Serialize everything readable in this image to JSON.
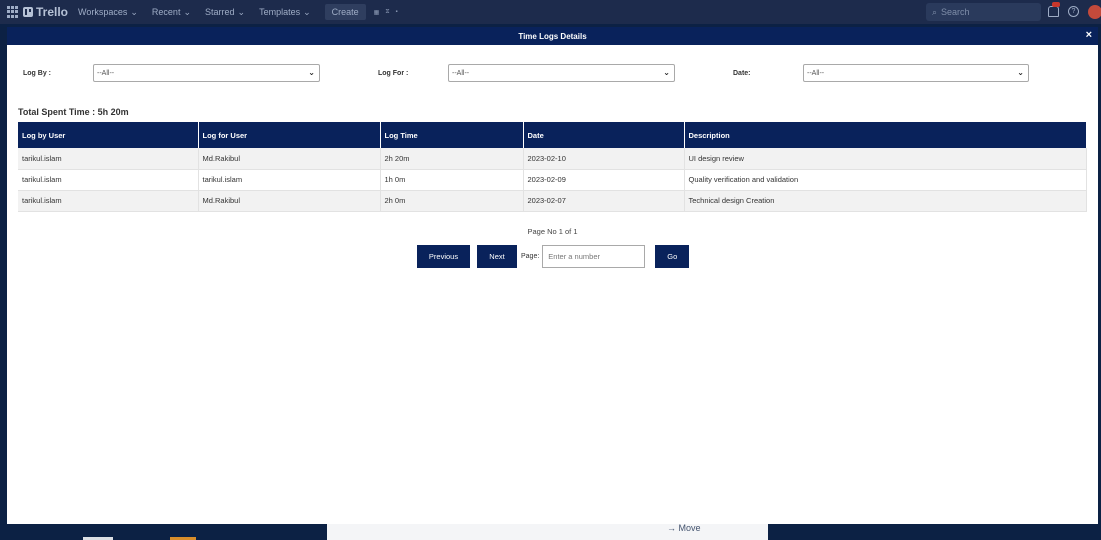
{
  "topbar": {
    "brand": "Trello",
    "nav": [
      {
        "label": "Workspaces"
      },
      {
        "label": "Recent"
      },
      {
        "label": "Starred"
      },
      {
        "label": "Templates"
      }
    ],
    "create_label": "Create",
    "search_placeholder": "Search"
  },
  "modal": {
    "title": "Time Logs Details",
    "close_label": "×"
  },
  "filters": {
    "log_by": {
      "label": "Log By :",
      "value": "--All--"
    },
    "log_for": {
      "label": "Log For :",
      "value": "--All--"
    },
    "date": {
      "label": "Date:",
      "value": "--All--"
    }
  },
  "total": "Total Spent Time : 5h 20m",
  "table": {
    "headers": [
      "Log by User",
      "Log for User",
      "Log Time",
      "Date",
      "Description"
    ],
    "rows": [
      [
        "tarikul.islam",
        "Md.Rakibul",
        "2h 20m",
        "2023-02-10",
        "UI design review"
      ],
      [
        "tarikul.islam",
        "tarikul.islam",
        "1h 0m",
        "2023-02-09",
        "Quality verification and validation"
      ],
      [
        "tarikul.islam",
        "Md.Rakibul",
        "2h 0m",
        "2023-02-07",
        "Technical design Creation"
      ]
    ]
  },
  "pagination": {
    "page_info": "Page No 1 of 1",
    "previous_label": "Previous",
    "next_label": "Next",
    "page_label": "Page:",
    "page_placeholder": "Enter a number",
    "go_label": "Go"
  },
  "background": {
    "move_label": "→ Move"
  }
}
